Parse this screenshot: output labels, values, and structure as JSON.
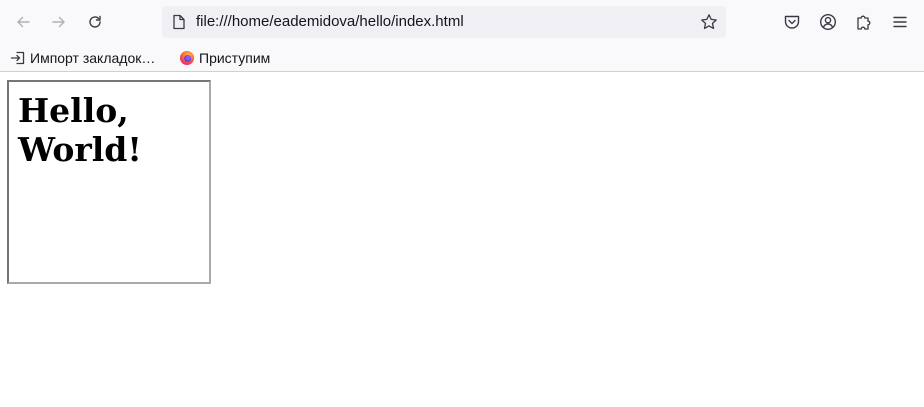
{
  "toolbar": {
    "url": "file:///home/eademidova/hello/index.html"
  },
  "bookmarks": {
    "items": [
      {
        "label": "Импорт закладок…",
        "icon": "import-icon"
      },
      {
        "label": "Приступим",
        "icon": "firefox-icon"
      }
    ]
  },
  "page": {
    "heading": "Hello, World!"
  },
  "colors": {
    "toolbar_bg": "#f9f9fb",
    "urlbar_bg": "#f0f0f4",
    "icon": "#5b5b66",
    "icon_disabled": "#a0a0a8"
  }
}
